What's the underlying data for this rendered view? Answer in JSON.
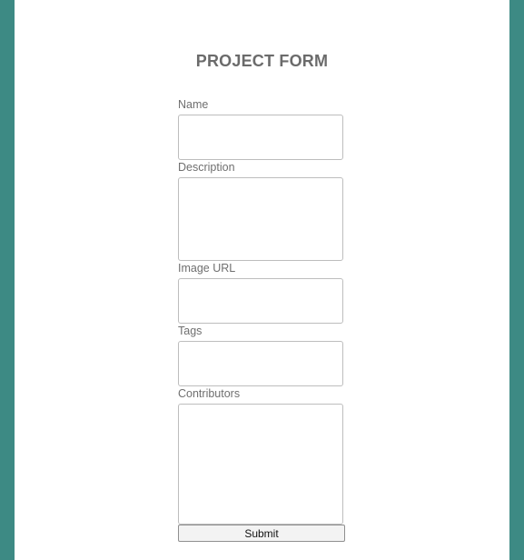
{
  "form": {
    "title": "PROJECT FORM",
    "fields": [
      {
        "label": "Name",
        "value": "",
        "placeholder": ""
      },
      {
        "label": "Description",
        "value": "",
        "placeholder": ""
      },
      {
        "label": "Image URL",
        "value": "",
        "placeholder": ""
      },
      {
        "label": "Tags",
        "value": "",
        "placeholder": ""
      },
      {
        "label": "Contributors",
        "value": "",
        "placeholder": ""
      }
    ],
    "submit_label": "Submit"
  },
  "colors": {
    "background": "#3d8a84",
    "panel": "#ffffff",
    "title": "#6b6b6b",
    "label": "#6f6f6f"
  }
}
